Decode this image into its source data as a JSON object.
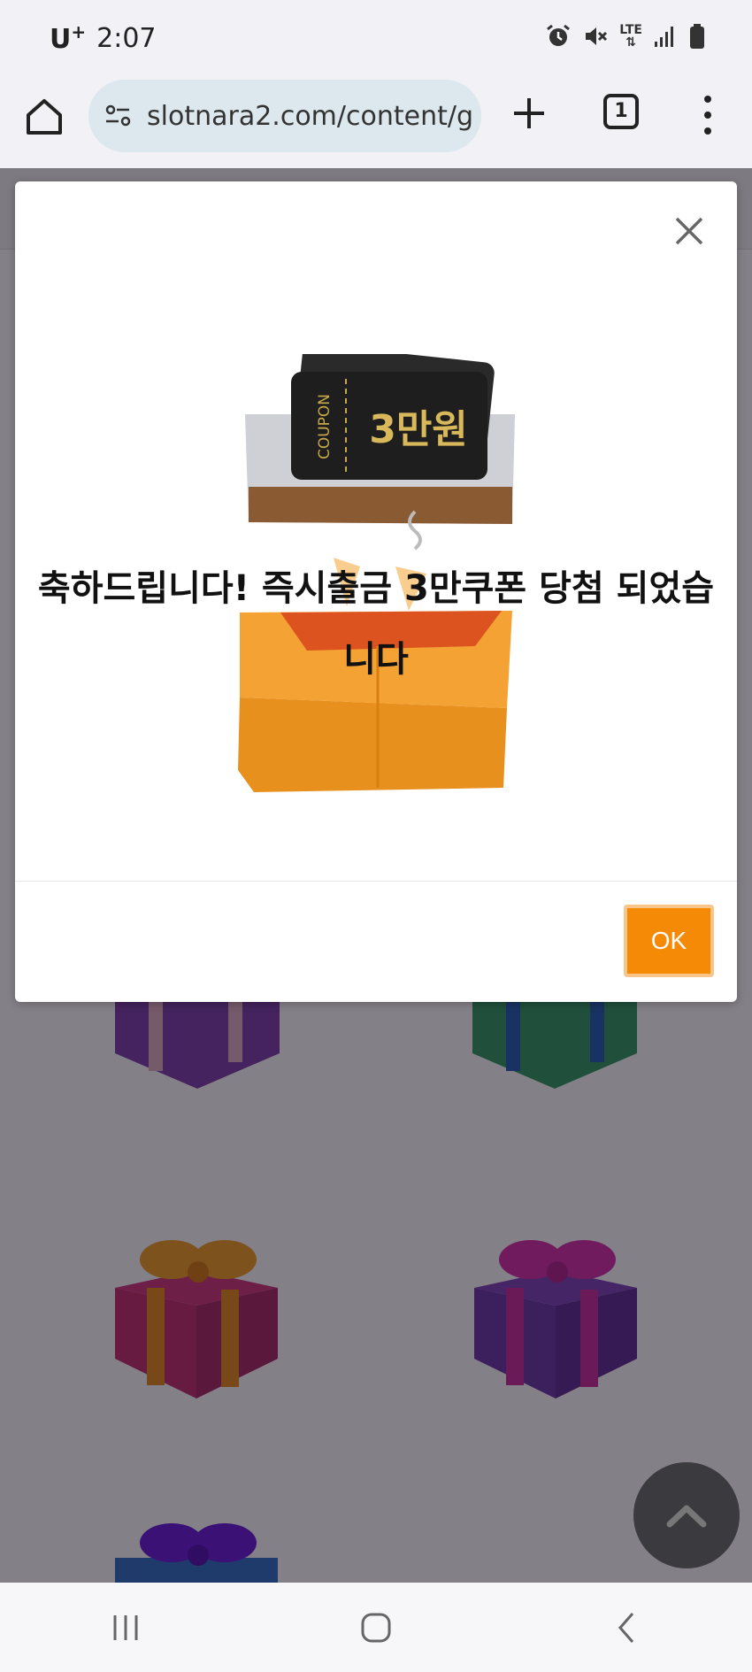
{
  "status_bar": {
    "carrier": "U",
    "carrier_sup": "+",
    "time": "2:07",
    "network": "LTE",
    "icons": [
      "alarm-icon",
      "mute-icon",
      "lte-icon",
      "signal-icon",
      "battery-icon"
    ]
  },
  "browser": {
    "url": "slotnara2.com/content/g",
    "tab_count": "1",
    "icons": [
      "home-icon",
      "site-settings-icon",
      "new-tab-icon",
      "tabs-icon",
      "more-menu-icon"
    ]
  },
  "modal": {
    "message": "축하드립니다! 즉시출금 3만쿠폰 당첨 되었습니다",
    "ok_label": "OK",
    "illustration": {
      "coupon_word": "COUPON",
      "coupon_amount": "3만원"
    }
  },
  "colors": {
    "ok_button": "#f58a07",
    "ok_button_border": "#f9c58a",
    "overlay": "rgba(20,12,26,0.52)",
    "url_bar": "#dce8ee",
    "gift_box_orange": "#f0a028"
  }
}
